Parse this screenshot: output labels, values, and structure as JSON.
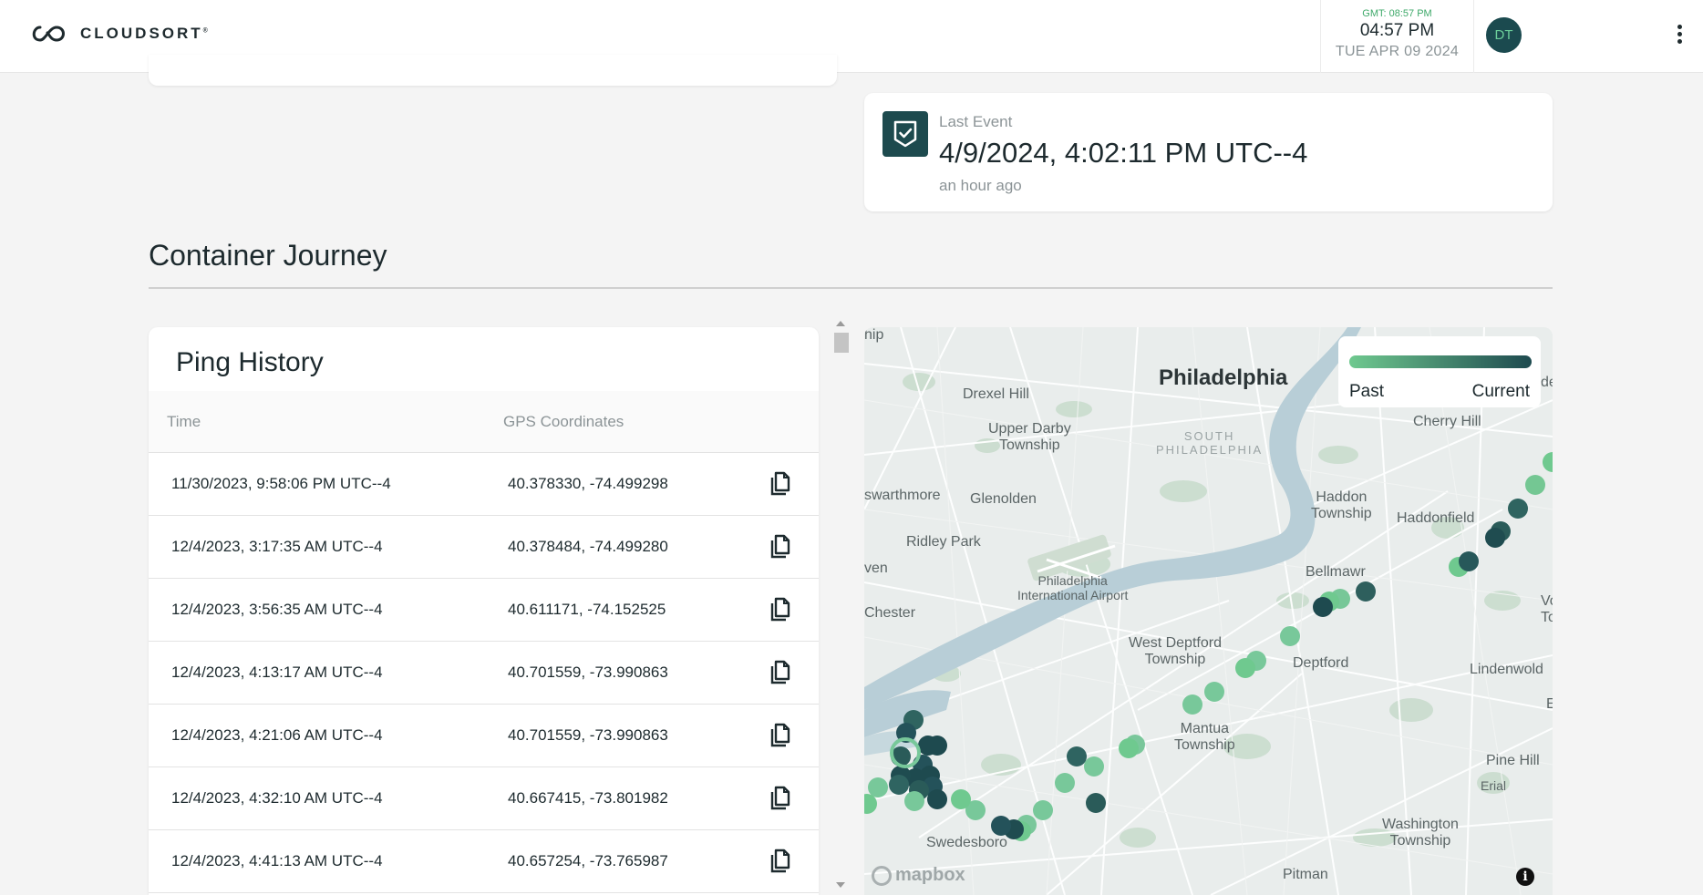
{
  "header": {
    "logo_text": "CLOUDSORT",
    "logo_mark": "®",
    "gmt": "GMT: 08:57 PM",
    "time": "04:57 PM",
    "date": "TUE APR 09 2024",
    "avatar_initials": "DT"
  },
  "last_event": {
    "label": "Last Event",
    "value": "4/9/2024, 4:02:11 PM UTC--4",
    "relative": "an hour ago"
  },
  "section_title": "Container Journey",
  "ping_history": {
    "title": "Ping History",
    "columns": [
      "Time",
      "GPS Coordinates"
    ],
    "rows": [
      {
        "time": "11/30/2023, 9:58:06 PM UTC--4",
        "gps": "40.378330, -74.499298"
      },
      {
        "time": "12/4/2023, 3:17:35 AM UTC--4",
        "gps": "40.378484, -74.499280"
      },
      {
        "time": "12/4/2023, 3:56:35 AM UTC--4",
        "gps": "40.611171, -74.152525"
      },
      {
        "time": "12/4/2023, 4:13:17 AM UTC--4",
        "gps": "40.701559, -73.990863"
      },
      {
        "time": "12/4/2023, 4:21:06 AM UTC--4",
        "gps": "40.701559, -73.990863"
      },
      {
        "time": "12/4/2023, 4:32:10 AM UTC--4",
        "gps": "40.667415, -73.801982"
      },
      {
        "time": "12/4/2023, 4:41:13 AM UTC--4",
        "gps": "40.657254, -73.765987"
      }
    ]
  },
  "map": {
    "legend_past": "Past",
    "legend_current": "Current",
    "attribution": "mapbox",
    "colors": {
      "past": "#6fc98f",
      "current": "#1e4a4f",
      "water": "#b9cfd8",
      "land": "#e8eceb"
    },
    "labels": {
      "philadelphia": "Philadelphia",
      "drexel_hill": "Drexel Hill",
      "upper_darby_1": "Upper Darby",
      "upper_darby_2": "Township",
      "south_philly_1": "SOUTH",
      "south_philly_2": "PHILADELPHIA",
      "cherry_hill": "Cherry Hill",
      "swarthmore": "swarthmore",
      "glenolden": "Glenolden",
      "haddon_1": "Haddon",
      "haddon_2": "Township",
      "haddonfield": "Haddonfield",
      "ridley_park": "Ridley Park",
      "ven": "ven",
      "airport_1": "Philadelphia",
      "airport_2": "International Airport",
      "bellmawr": "Bellmawr",
      "chester": "Chester",
      "west_deptford_1": "West Deptford",
      "west_deptford_2": "Township",
      "deptford": "Deptford",
      "lindenwold": "Lindenwold",
      "mantua_1": "Mantua",
      "mantua_2": "Township",
      "pine_hill": "Pine Hill",
      "erial": "Erial",
      "swedesboro": "Swedesboro",
      "washington_1": "Washington",
      "washington_2": "Township",
      "pitman": "Pitman",
      "hip": "hip",
      "vo": "Vo",
      "to": "To",
      "de": "de",
      "e": "E"
    }
  }
}
